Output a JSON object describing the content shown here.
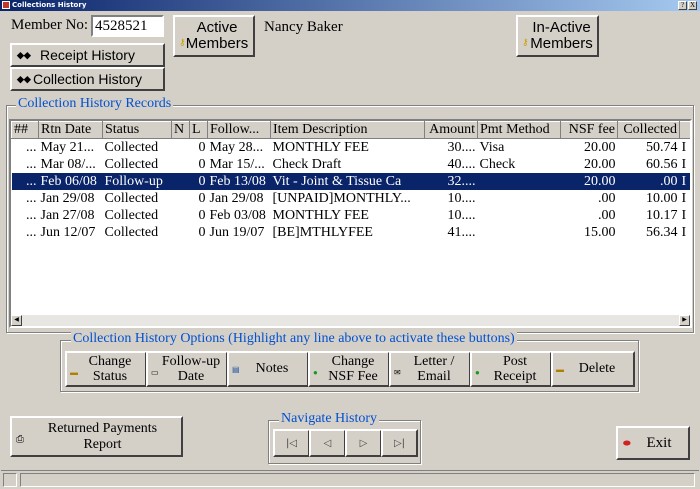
{
  "window": {
    "title": "Collections History",
    "help_label": "?",
    "close_label": "X"
  },
  "member": {
    "label": "Member No:",
    "number": "4528521",
    "name": "Nancy Baker"
  },
  "buttons": {
    "receipt_history": "Receipt History",
    "collection_history": "Collection History",
    "active_members_line1": "Active",
    "active_members_line2": "Members",
    "inactive_members_line1": "In-Active",
    "inactive_members_line2": "Members"
  },
  "records": {
    "legend": "Collection History Records",
    "columns": [
      "##",
      "Rtn Date",
      "Status",
      "N",
      "L",
      "Follow...",
      "Item Description",
      "Amount",
      "Pmt Method",
      "NSF fee",
      "Collected",
      ""
    ],
    "rows": [
      [
        "...",
        "May 21...",
        "Collected",
        "",
        "0",
        "May 28...",
        "MONTHLY FEE",
        "30....",
        "Visa",
        "20.00",
        "50.74",
        "I"
      ],
      [
        "...",
        "Mar 08/...",
        "Collected",
        "",
        "0",
        "Mar 15/...",
        "Check Draft",
        "40....",
        "Check",
        "20.00",
        "60.56",
        "I"
      ],
      [
        "...",
        "Feb 06/08",
        "Follow-up",
        "",
        "0",
        "Feb 13/08",
        "Vit - Joint & Tissue Ca",
        "32....",
        "",
        "20.00",
        ".00",
        "I"
      ],
      [
        "...",
        "Jan 29/08",
        "Collected",
        "",
        "0",
        "Jan 29/08",
        "[UNPAID]MONTHLY...",
        "10....",
        "",
        ".00",
        "10.00",
        "I"
      ],
      [
        "...",
        "Jan 27/08",
        "Collected",
        "",
        "0",
        "Feb 03/08",
        "MONTHLY FEE",
        "10....",
        "",
        ".00",
        "10.17",
        "I"
      ],
      [
        "...",
        "Jun 12/07",
        "Collected",
        "",
        "0",
        "Jun 19/07",
        "[BE]MTHLYFEE",
        "41....",
        "",
        "15.00",
        "56.34",
        "I"
      ]
    ],
    "selected_row": 2
  },
  "options": {
    "legend": "Collection History Options (Highlight any line above to activate these buttons)",
    "change_status_1": "Change",
    "change_status_2": "Status",
    "followup_date_1": "Follow-up",
    "followup_date_2": "Date",
    "notes": "Notes",
    "change_nsf_1": "Change",
    "change_nsf_2": "NSF Fee",
    "letter_email_1": "Letter /",
    "letter_email_2": "Email",
    "post_receipt_1": "Post",
    "post_receipt_2": "Receipt",
    "delete": "Delete"
  },
  "returned_payments_1": "Returned Payments",
  "returned_payments_2": "Report",
  "navigate": {
    "legend": "Navigate History",
    "first": "|◁",
    "prev": "◁",
    "next": "▷",
    "last": "▷|"
  },
  "exit": "Exit",
  "colors": {
    "background": "#d4d0c8",
    "selection": "#0a246a",
    "legend_text": "#0050d0"
  }
}
